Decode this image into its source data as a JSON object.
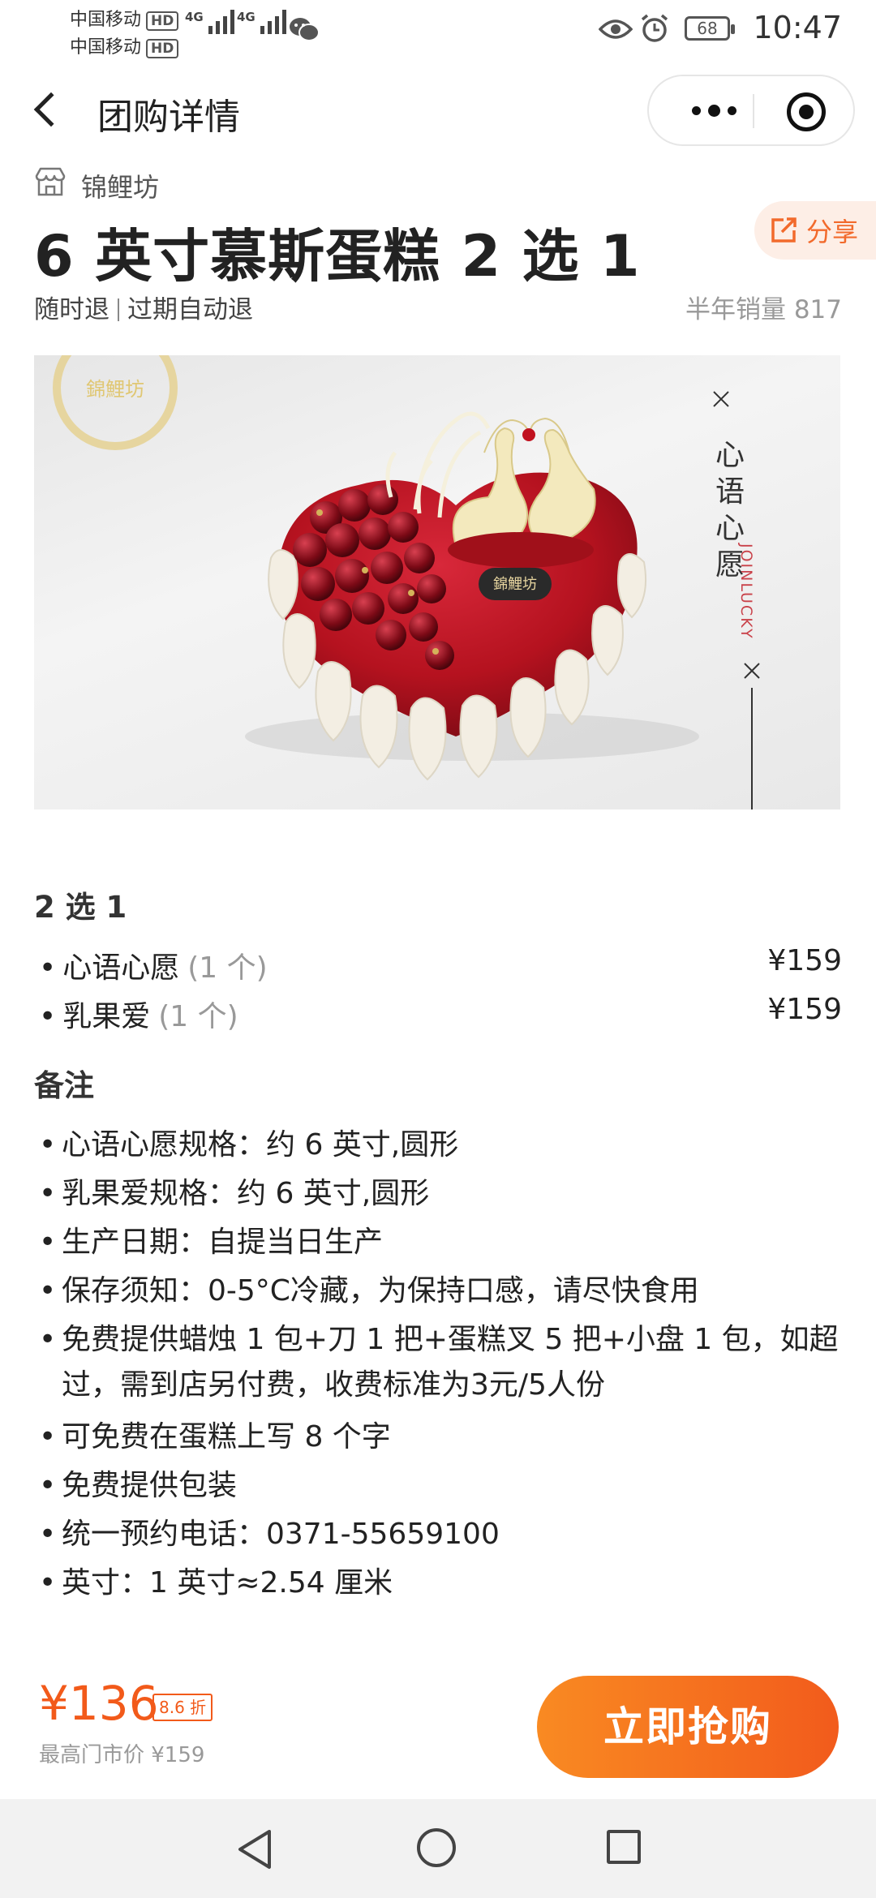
{
  "status_bar": {
    "carrier_1": "中国移动",
    "carrier_2": "中国移动",
    "hd": "HD",
    "network": "4G",
    "battery": "68",
    "time": "10:47"
  },
  "nav": {
    "title": "团购详情"
  },
  "shop": {
    "name": "锦鲤坊",
    "icon": "store-icon"
  },
  "share": {
    "label": "分享",
    "icon": "share-icon"
  },
  "product": {
    "title": "6 英寸慕斯蛋糕 2 选 1",
    "tag_1": "随时退",
    "tag_2": "过期自动退",
    "sales": "半年销量 817"
  },
  "image": {
    "brand_logo_text": "錦鯉坊",
    "vertical_text": "心语心愿",
    "side_text": "JOINLUCKY",
    "plaque_text": "錦鯉坊"
  },
  "options": {
    "title": "2 选 1",
    "items": [
      {
        "name": "心语心愿",
        "qty": "(1 个)",
        "price": "¥159"
      },
      {
        "name": "乳果爱",
        "qty": "(1 个)",
        "price": "¥159"
      }
    ]
  },
  "notes": {
    "title": "备注",
    "items": [
      "心语心愿规格：约 6 英寸,圆形",
      "乳果爱规格：约 6 英寸,圆形",
      "生产日期：自提当日生产",
      "保存须知：0-5°C冷藏，为保持口感，请尽快食用",
      "免费提供蜡烛 1 包+刀 1 把+蛋糕叉 5 把+小盘 1 包，如超过，需到店另付费，收费标准为3元/5人份",
      "可免费在蛋糕上写 8 个字",
      "免费提供包装",
      "统一预约电话：0371-55659100",
      "英寸：1 英寸≈2.54 厘米"
    ]
  },
  "bottom": {
    "price": "¥136",
    "discount": "8.6 折",
    "original": "最高门市价 ¥159",
    "buy_label": "立即抢购"
  },
  "colors": {
    "accent": "#f25a1a",
    "button_start": "#f98a22",
    "button_end": "#f25b1c",
    "share_bg": "#fdeee6"
  }
}
